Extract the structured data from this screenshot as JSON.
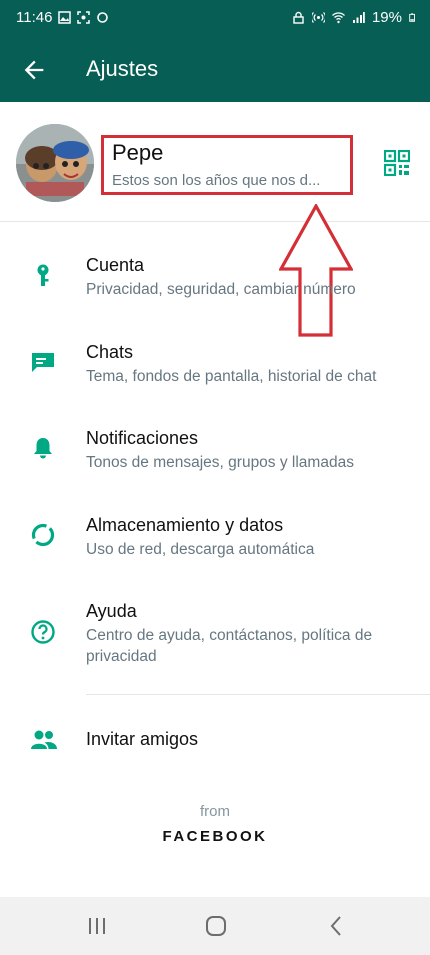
{
  "status_bar": {
    "time": "11:46",
    "battery": "19%"
  },
  "app_bar": {
    "title": "Ajustes"
  },
  "profile": {
    "name": "Pepe",
    "status": "Estos son los años que nos d..."
  },
  "menu": [
    {
      "icon": "key-icon",
      "title": "Cuenta",
      "subtitle": "Privacidad, seguridad, cambiar número"
    },
    {
      "icon": "chat-icon",
      "title": "Chats",
      "subtitle": "Tema, fondos de pantalla, historial de chat"
    },
    {
      "icon": "bell-icon",
      "title": "Notificaciones",
      "subtitle": "Tonos de mensajes, grupos y llamadas"
    },
    {
      "icon": "storage-icon",
      "title": "Almacenamiento y datos",
      "subtitle": "Uso de red, descarga automática"
    },
    {
      "icon": "help-icon",
      "title": "Ayuda",
      "subtitle": "Centro de ayuda, contáctanos, política de privacidad"
    },
    {
      "icon": "people-icon",
      "title": "Invitar amigos",
      "subtitle": ""
    }
  ],
  "footer": {
    "from": "from",
    "brand": "FACEBOOK"
  },
  "colors": {
    "header": "#075e54",
    "icon": "#00a884",
    "highlight": "#d42f36"
  }
}
